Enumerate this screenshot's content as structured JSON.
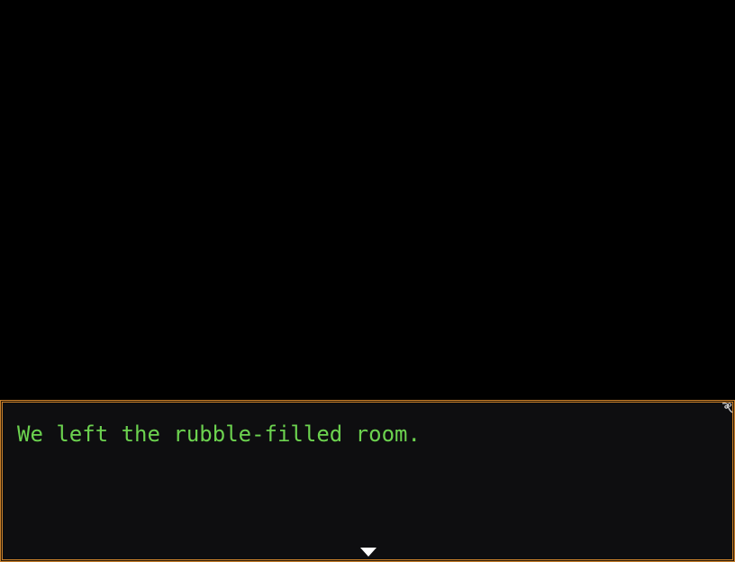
{
  "message_window": {
    "text": "We left the rubble-filled room."
  },
  "icons": {
    "continue": "continue-arrow-icon",
    "corner": "corner-ornament-icon"
  },
  "colors": {
    "background": "#000000",
    "window_background": "#0e0e10",
    "window_border": "#c77f2a",
    "text": "#6cd24f",
    "arrow": "#ffffff"
  }
}
